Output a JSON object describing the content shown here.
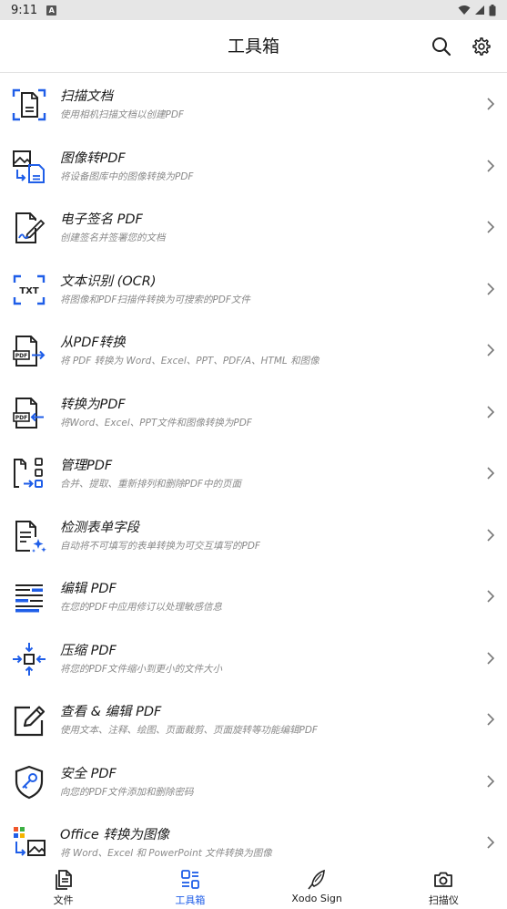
{
  "status_bar": {
    "time": "9:11",
    "notification": "A"
  },
  "header": {
    "title": "工具箱"
  },
  "colors": {
    "accent": "#1f5ee8",
    "text": "#1a1a1a",
    "subtext": "#8a8a8a"
  },
  "tools": [
    {
      "title": "扫描文档",
      "subtitle": "使用相机扫描文档以创建PDF",
      "icon": "scan-document-icon"
    },
    {
      "title": "图像转PDF",
      "subtitle": "将设备图库中的图像转换为PDF",
      "icon": "image-to-pdf-icon"
    },
    {
      "title": "电子签名 PDF",
      "subtitle": "创建签名并签署您的文档",
      "icon": "signature-icon"
    },
    {
      "title": "文本识别 (OCR)",
      "subtitle": "将图像和PDF扫描件转换为可搜索的PDF文件",
      "icon": "ocr-icon"
    },
    {
      "title": "从PDF转换",
      "subtitle": "将 PDF 转换为 Word、Excel、PPT、PDF/A、HTML 和图像",
      "icon": "convert-from-pdf-icon"
    },
    {
      "title": "转换为PDF",
      "subtitle": "将Word、Excel、PPT文件和图像转换为PDF",
      "icon": "convert-to-pdf-icon"
    },
    {
      "title": "管理PDF",
      "subtitle": "合并、提取、重新排列和删除PDF中的页面",
      "icon": "manage-pdf-icon"
    },
    {
      "title": "检测表单字段",
      "subtitle": "自动将不可填写的表单转换为可交互填写的PDF",
      "icon": "detect-form-icon"
    },
    {
      "title": "编辑 PDF",
      "subtitle": "在您的PDF中应用修订以处理敏感信息",
      "icon": "redact-icon"
    },
    {
      "title": "压缩 PDF",
      "subtitle": "将您的PDF文件缩小到更小的文件大小",
      "icon": "compress-icon"
    },
    {
      "title": "查看 & 编辑 PDF",
      "subtitle": "使用文本、注释、绘图、页面裁剪、页面旋转等功能编辑PDF",
      "icon": "edit-pen-icon"
    },
    {
      "title": "安全 PDF",
      "subtitle": "向您的PDF文件添加和删除密码",
      "icon": "security-shield-icon"
    },
    {
      "title": "Office 转换为图像",
      "subtitle": "将 Word、Excel 和 PowerPoint 文件转换为图像",
      "icon": "office-to-image-icon"
    }
  ],
  "bottom_nav": [
    {
      "label": "文件",
      "icon": "files-icon",
      "active": false
    },
    {
      "label": "工具箱",
      "icon": "toolbox-icon",
      "active": true
    },
    {
      "label": "Xodo Sign",
      "icon": "xodo-sign-icon",
      "active": false
    },
    {
      "label": "扫描仪",
      "icon": "camera-icon",
      "active": false
    }
  ]
}
